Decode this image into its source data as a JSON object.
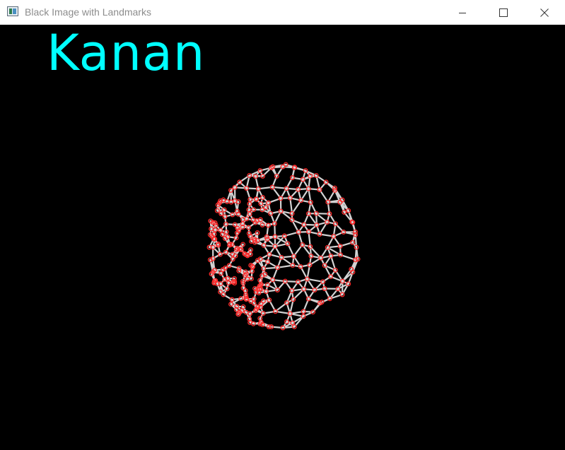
{
  "window": {
    "title": "Black Image with Landmarks",
    "icon": "opencv-window-icon",
    "controls": [
      "minimize-icon",
      "maximize-icon",
      "close-icon"
    ]
  },
  "canvas": {
    "background": "#000000",
    "label": "Kanan",
    "label_color": "#00ffff",
    "mesh_line_color": "#d3d3d3",
    "landmark_color": "#ff2a2a"
  }
}
